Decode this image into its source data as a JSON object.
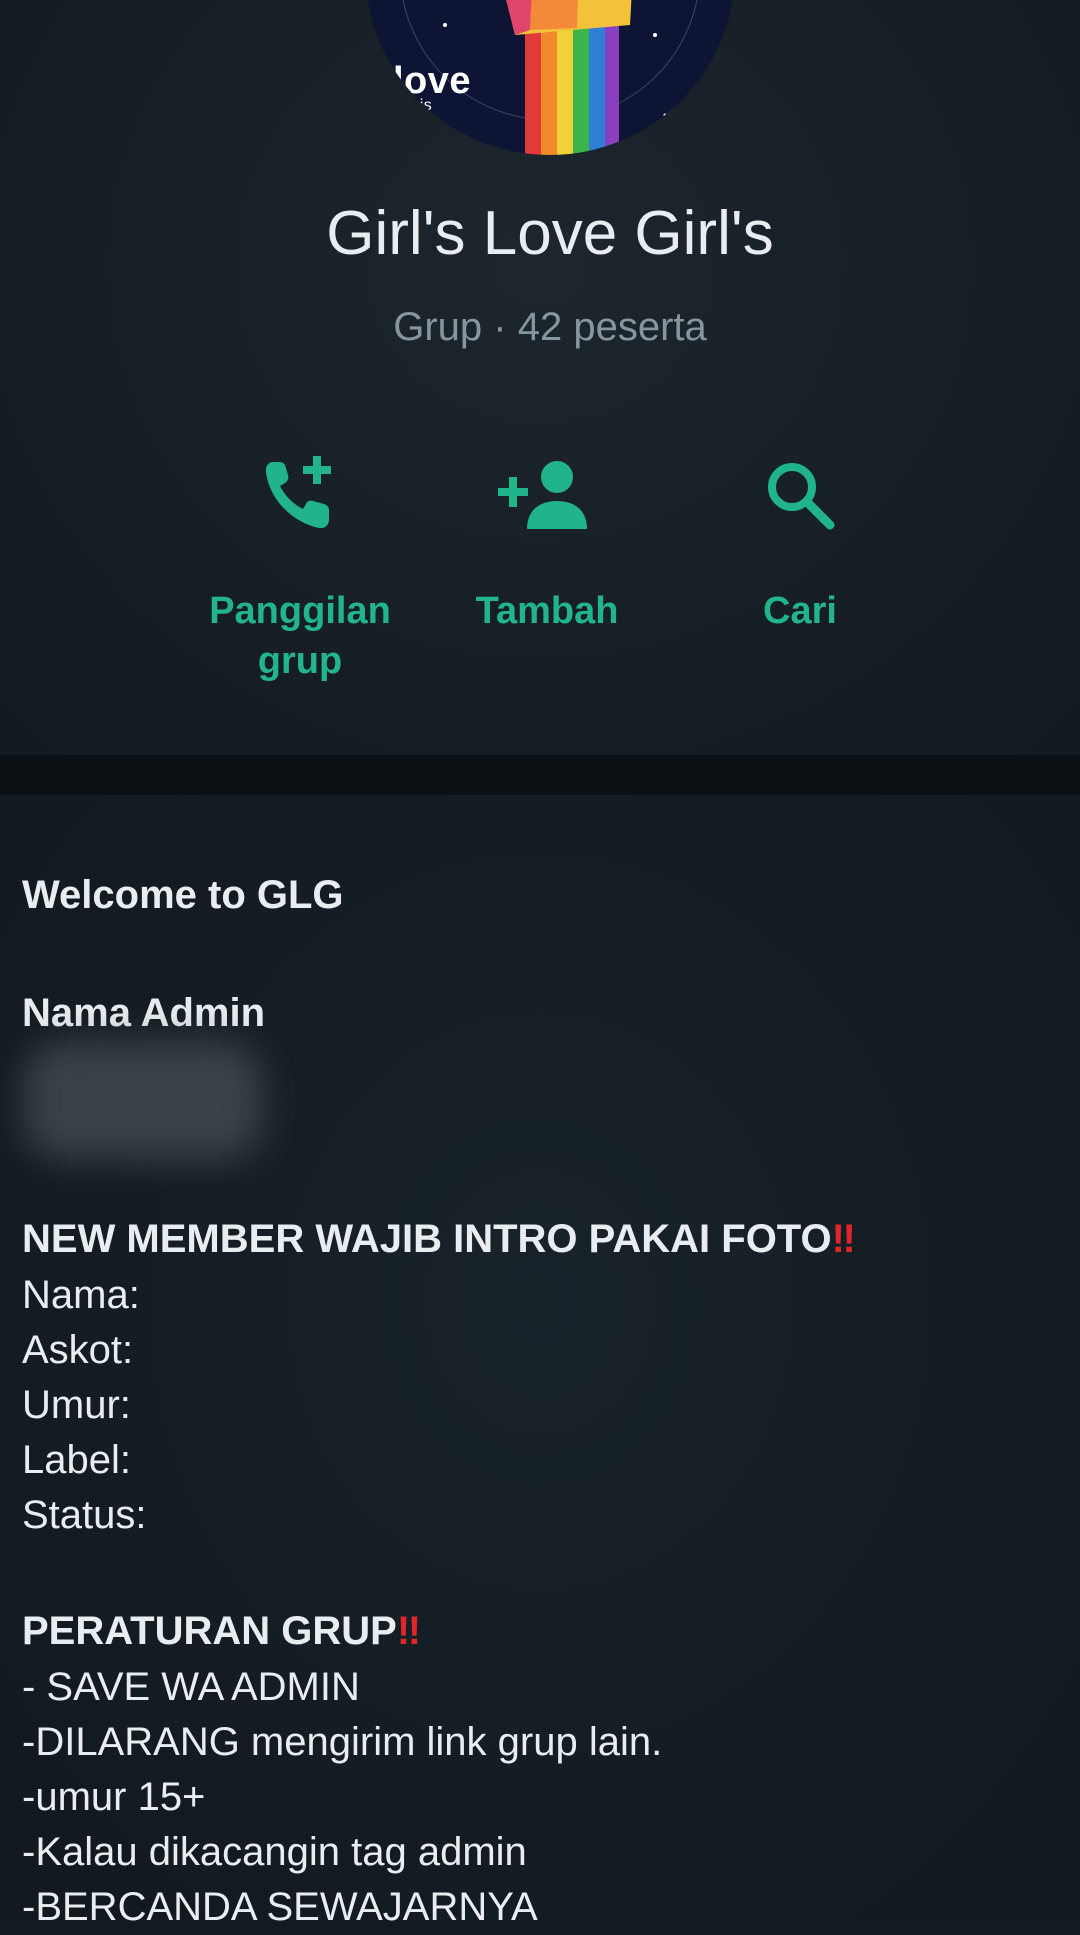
{
  "header": {
    "avatar": {
      "word": "love",
      "small": "is",
      "script": "love"
    },
    "group_name": "Girl's Love Girl's",
    "group_subtitle": "Grup · 42 peserta",
    "actions": [
      {
        "icon": "phone-add-icon",
        "label_line1": "Panggilan",
        "label_line2": "grup"
      },
      {
        "icon": "add-person-icon",
        "label": "Tambah"
      },
      {
        "icon": "search-icon",
        "label": "Cari"
      }
    ],
    "accent_color": "#21b38a"
  },
  "description": {
    "welcome": "Welcome to GLG",
    "admin_heading": "Nama Admin",
    "intro_heading": "NEW MEMBER WAJIB INTRO PAKAI FOTO",
    "intro_fields": [
      "Nama:",
      "Askot:",
      "Umur:",
      "Label:",
      "Status:"
    ],
    "rules_heading": "PERATURAN GRUP",
    "rules": [
      "- SAVE WA ADMIN",
      "-DILARANG mengirim link grup lain.",
      "-umur 15+",
      "-Kalau dikacangin tag admin",
      "-BERCANDA SEWAJARNYA"
    ],
    "emphasis": "‼"
  }
}
